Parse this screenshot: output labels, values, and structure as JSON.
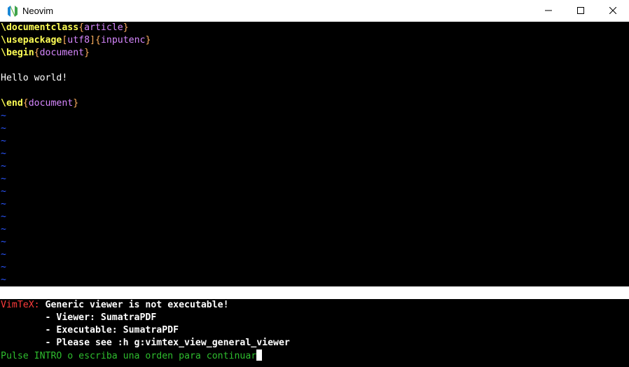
{
  "window": {
    "title": "Neovim",
    "icon": "neovim-logo-icon",
    "controls": [
      "minimize-icon",
      "maximize-icon",
      "close-icon"
    ]
  },
  "colors": {
    "command": "#ffff55",
    "brace": "#ffaf5f",
    "argument": "#d787ff",
    "tilde": "#2a56ff",
    "error": "#ff3b3b",
    "prompt": "#2ebd2e"
  },
  "editor": {
    "line1": {
      "cmd": "\\documentclass",
      "open": "{",
      "arg": "article",
      "close": "}"
    },
    "line2": {
      "cmd": "\\usepackage",
      "opt_open": "[",
      "opt": "utf8",
      "opt_close": "]",
      "open": "{",
      "arg": "inputenc",
      "close": "}"
    },
    "line3": {
      "cmd": "\\begin",
      "open": "{",
      "arg": "document",
      "close": "}"
    },
    "line4": "",
    "line5": "Hello world!",
    "line6": "",
    "line7": {
      "cmd": "\\end",
      "open": "{",
      "arg": "document",
      "close": "}"
    },
    "tilde": "~"
  },
  "messages": {
    "tag": "VimTeX:",
    "error": " Generic viewer is not executable!",
    "detail1": "        - Viewer: SumatraPDF",
    "detail2": "        - Executable: SumatraPDF",
    "detail3": "        - Please see :h g:vimtex_view_general_viewer",
    "prompt": "Pulse INTRO o escriba una orden para continuar"
  }
}
